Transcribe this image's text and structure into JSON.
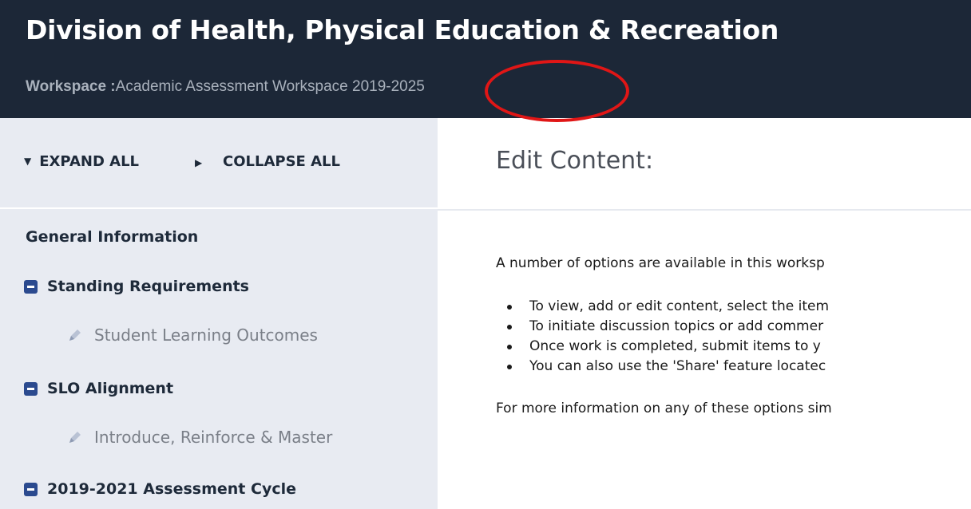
{
  "header": {
    "title": "Division of Health, Physical Education & Recreation",
    "workspace_label": "Workspace :",
    "workspace_name": "Academic Assessment Workspace 2019-2025"
  },
  "sidebar": {
    "expand_all": "EXPAND ALL",
    "collapse_all": "COLLAPSE ALL",
    "items": [
      {
        "label": "General Information",
        "type": "plain"
      },
      {
        "label": "Standing Requirements",
        "type": "group"
      },
      {
        "label": "Student Learning Outcomes",
        "type": "child"
      },
      {
        "label": "SLO Alignment",
        "type": "group"
      },
      {
        "label": "Introduce, Reinforce & Master",
        "type": "child"
      },
      {
        "label": "2019-2021 Assessment Cycle",
        "type": "group"
      }
    ]
  },
  "main": {
    "title": "Edit Content:",
    "intro": "A number of options are available in this worksp",
    "bullets": [
      "To view, add or edit content, select the item",
      "To initiate discussion topics or add commer",
      "Once work is completed, submit items to y",
      "You can also use the 'Share' feature locatec"
    ],
    "footer": "For more information on any of these options sim"
  },
  "colors": {
    "header_bg": "#1c2737",
    "sidebar_bg": "#e8ebf2",
    "group_icon": "#2b4a8f",
    "annotation": "#e01616"
  },
  "icons": {
    "group_toggle": "minus-square-icon",
    "child_item": "pencil-icon",
    "expand": "caret-down-icon",
    "collapse": "caret-right-icon"
  }
}
